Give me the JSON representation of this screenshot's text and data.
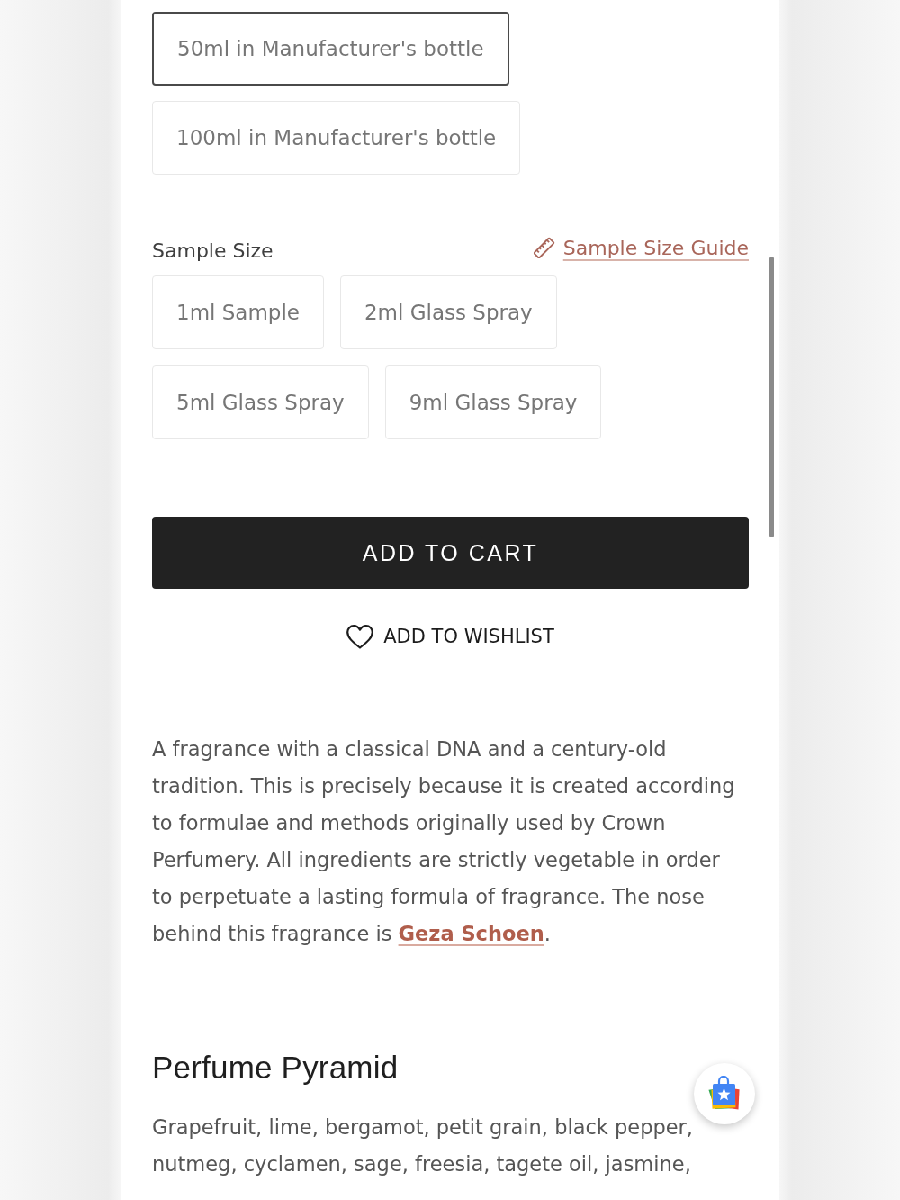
{
  "bottle_options": [
    {
      "label": "50ml in Manufacturer's bottle",
      "selected": true
    },
    {
      "label": "100ml in Manufacturer's bottle",
      "selected": false
    }
  ],
  "sample_size": {
    "label": "Sample Size",
    "guide_link": "Sample Size Guide",
    "options": [
      {
        "label": "1ml Sample",
        "selected": false
      },
      {
        "label": "2ml Glass Spray",
        "selected": false
      },
      {
        "label": "5ml Glass Spray",
        "selected": false
      },
      {
        "label": "9ml Glass Spray",
        "selected": false
      }
    ]
  },
  "add_to_cart": "ADD TO CART",
  "wishlist": "ADD TO WISHLIST",
  "description": {
    "text": "A fragrance with a classical DNA and a century-old tradition. This is precisely because it is created according to formulae and methods originally used by Crown Perfumery. All ingredients are strictly vegetable in order to perpetuate a lasting formula of fragrance. The nose behind this fragrance is ",
    "link": "Geza Schoen",
    "after": "."
  },
  "pyramid": {
    "title": "Perfume Pyramid",
    "notes": "Grapefruit, lime, bergamot, petit grain, black pepper, nutmeg, cyclamen, sage, freesia, tagete oil, jasmine,"
  }
}
